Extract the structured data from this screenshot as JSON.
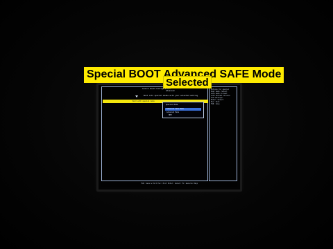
{
  "overlay": {
    "caption_main": "Special BOOT Advanced SAFE Mode",
    "caption_sub": "Selected"
  },
  "bios": {
    "header_lines": [
      "Launch Sound Configuration",
      "Advanced",
      "Boot into special modes with your selected setting"
    ],
    "highlighted_item": "Boot with special mode",
    "popup": {
      "title": "Special Mode",
      "options": [
        {
          "label": "Advanced Safe Mode",
          "selected": true
        },
        {
          "label": "Advanced Mode",
          "selected": false
        }
      ]
    },
    "small_tag": "HPE",
    "help_text": [
      "Options for special",
      "boot mode. Select",
      "safe mode to boot",
      "with minimal drivers",
      "and settings.",
      "",
      "Enter: Select",
      "Esc: Exit",
      "F10: Save"
    ],
    "footer": "F10: Save & Exit  Esc: Exit  Enter: Select  F1: General Help"
  }
}
